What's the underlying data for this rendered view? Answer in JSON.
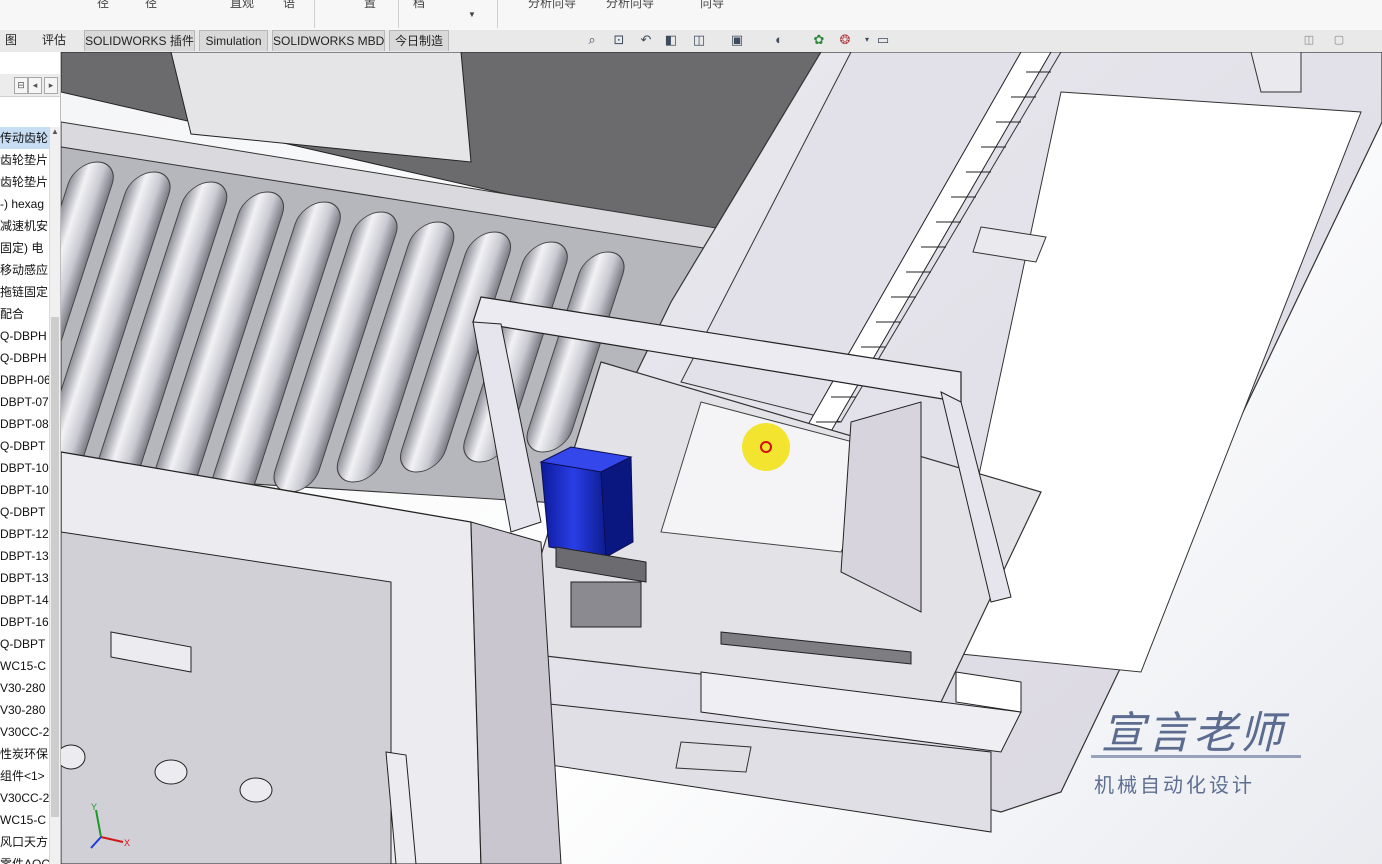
{
  "ribbon": {
    "fragments": [
      "径",
      "径",
      "直观",
      "语",
      "置",
      "档",
      "分析向导",
      "分析向导",
      "向导"
    ]
  },
  "tabs": [
    "图",
    "评估",
    "SOLIDWORKS 插件",
    "Simulation",
    "SOLIDWORKS MBD",
    "今日制造"
  ],
  "tree": {
    "items": [
      "传动齿轮",
      "齿轮垫片",
      "齿轮垫片",
      "-) hexag",
      "减速机安",
      "固定) 电",
      "移动感应",
      "拖链固定",
      "配合",
      "Q-DBPH",
      "Q-DBPH",
      "DBPH-06",
      "DBPT-07",
      "DBPT-08",
      "Q-DBPT",
      "DBPT-10",
      "DBPT-10",
      "Q-DBPT",
      "DBPT-12",
      "DBPT-13",
      "DBPT-13",
      "DBPT-14",
      "DBPT-16",
      "Q-DBPT",
      "WC15-C",
      "V30-280",
      "V30-280",
      "V30CC-2",
      "性炭环保",
      "组件<1>",
      "V30CC-2",
      "WC15-C",
      "风口天方",
      "零件AQC"
    ],
    "selected_index": 0
  },
  "watermark": {
    "name": "宣言老师",
    "subtitle": "机械自动化设计"
  },
  "triad": {
    "x_label": "X",
    "y_label": "Y",
    "z_label": "Z"
  },
  "colors": {
    "accent_blue": "#1a2fd0",
    "selection_yellow": "#f2e21a",
    "tree_selection": "#c7ddf3"
  }
}
